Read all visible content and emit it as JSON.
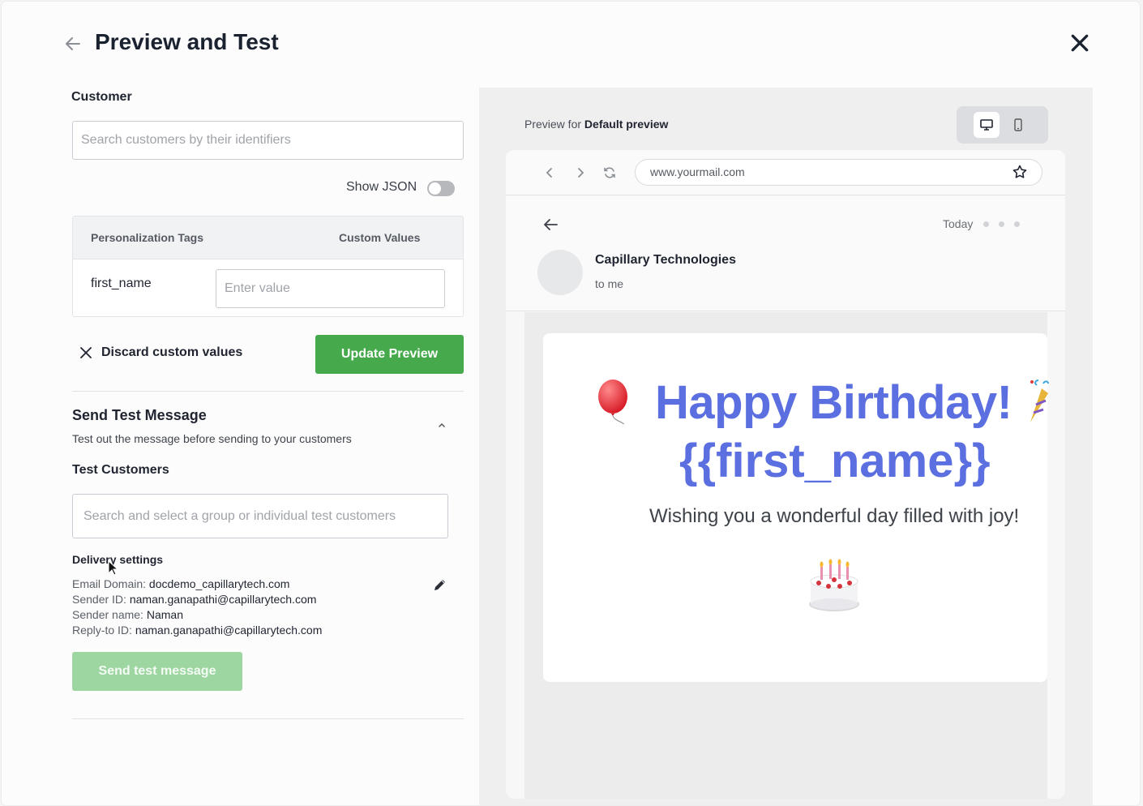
{
  "header": {
    "title": "Preview and Test"
  },
  "customer": {
    "label": "Customer",
    "search_placeholder": "Search customers by their identifiers",
    "show_json_label": "Show JSON",
    "show_json_on": false
  },
  "personalization": {
    "col_tags": "Personalization Tags",
    "col_values": "Custom Values",
    "rows": [
      {
        "tag": "first_name",
        "value": "",
        "placeholder": "Enter value"
      }
    ]
  },
  "actions": {
    "discard_label": "Discard custom values",
    "update_label": "Update Preview"
  },
  "send_test": {
    "title": "Send Test Message",
    "subtitle": "Test out the message before sending to your customers",
    "test_customers_label": "Test Customers",
    "test_customers_placeholder": "Search and select a group or individual test customers",
    "delivery": {
      "title": "Delivery settings",
      "rows": [
        {
          "key": "Email Domain:",
          "value": "docdemo_capillarytech.com"
        },
        {
          "key": "Sender ID:",
          "value": "naman.ganapathi@capillarytech.com"
        },
        {
          "key": "Sender name:",
          "value": "Naman"
        },
        {
          "key": "Reply-to ID:",
          "value": "naman.ganapathi@capillarytech.com"
        }
      ]
    },
    "send_label": "Send test message"
  },
  "preview": {
    "preview_for_label": "Preview for",
    "preview_for_value": "Default preview",
    "active_device": "desktop",
    "browser": {
      "url": "www.yourmail.com"
    },
    "email": {
      "date": "Today",
      "sender": "Capillary Technologies",
      "to": "to me",
      "heading_line1": "Happy Birthday!",
      "heading_line2": "{{first_name}}",
      "message": "Wishing you a wonderful day filled with joy!"
    }
  },
  "colors": {
    "primary_green": "#46a94c",
    "disabled_green": "#9dd6a1",
    "heading_blue": "#5b6fe0"
  },
  "icons": [
    "arrow-left-icon",
    "close-icon",
    "x-icon",
    "chevron-up-icon",
    "pencil-icon",
    "desktop-icon",
    "mobile-icon",
    "chevron-left-icon",
    "chevron-right-icon",
    "refresh-icon",
    "star-icon",
    "balloon-icon",
    "party-popper-icon",
    "cake-icon",
    "mouse-cursor-icon"
  ]
}
